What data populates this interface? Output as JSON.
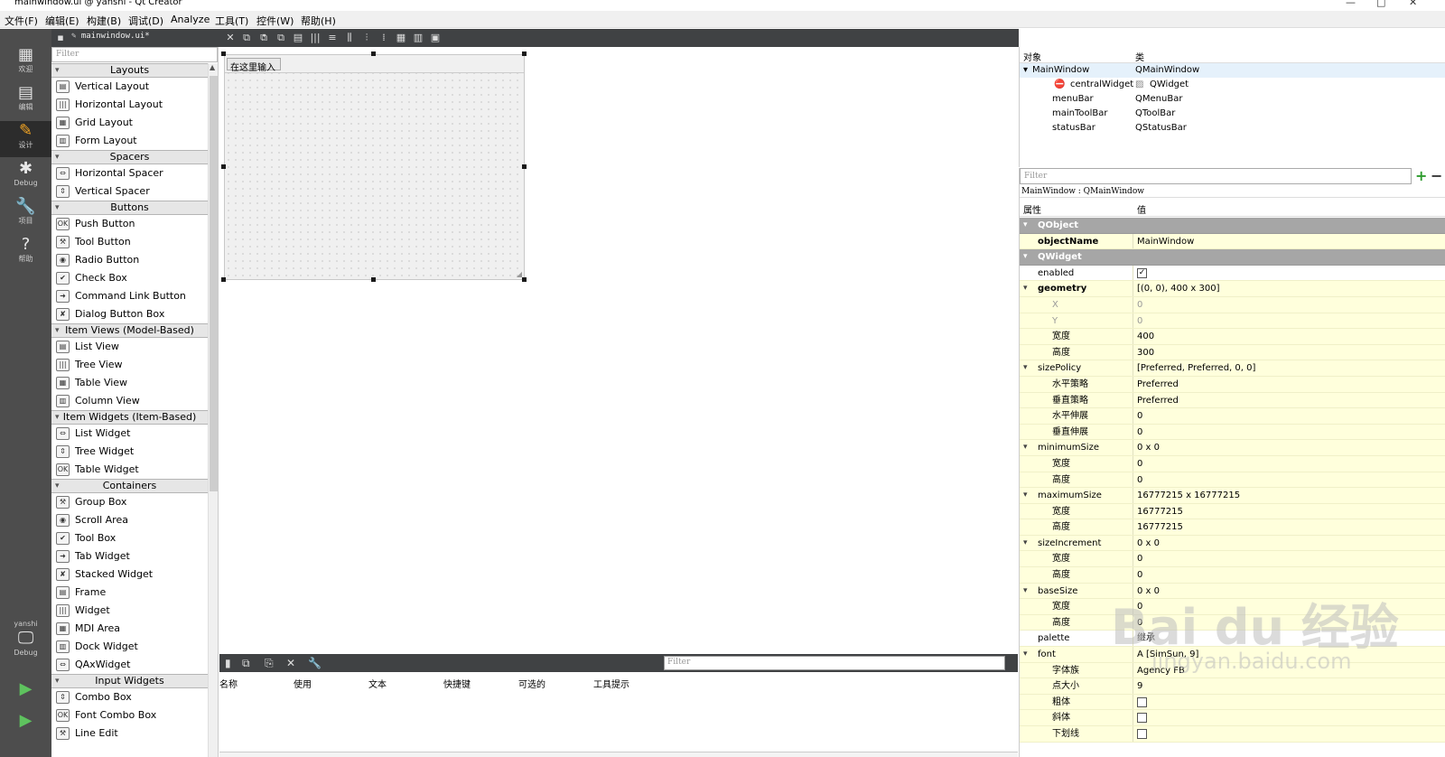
{
  "window": {
    "title": "mainwindow.ui @ yanshi - Qt Creator"
  },
  "menubar": {
    "items": [
      "文件(F)",
      "编辑(E)",
      "构建(B)",
      "调试(D)",
      "Analyze",
      "工具(T)",
      "控件(W)",
      "帮助(H)"
    ]
  },
  "modes": [
    {
      "icon": "grid-icon",
      "label": "欢迎"
    },
    {
      "icon": "edit-icon",
      "label": "编辑"
    },
    {
      "icon": "design-icon",
      "label": "设计"
    },
    {
      "icon": "debug-icon",
      "label": "Debug"
    },
    {
      "icon": "project-icon",
      "label": "项目"
    },
    {
      "icon": "help-icon",
      "label": "帮助"
    }
  ],
  "kit": {
    "project": "yanshi",
    "mode": "Debug"
  },
  "toolbar": {
    "document": "mainwindow.ui*"
  },
  "widgetbox": {
    "filter_placeholder": "Filter",
    "categories": [
      {
        "name": "Layouts",
        "items": [
          "Vertical Layout",
          "Horizontal Layout",
          "Grid Layout",
          "Form Layout"
        ]
      },
      {
        "name": "Spacers",
        "items": [
          "Horizontal Spacer",
          "Vertical Spacer"
        ]
      },
      {
        "name": "Buttons",
        "items": [
          "Push Button",
          "Tool Button",
          "Radio Button",
          "Check Box",
          "Command Link Button",
          "Dialog Button Box"
        ]
      },
      {
        "name": "Item Views (Model-Based)",
        "items": [
          "List View",
          "Tree View",
          "Table View",
          "Column View"
        ]
      },
      {
        "name": "Item Widgets (Item-Based)",
        "items": [
          "List Widget",
          "Tree Widget",
          "Table Widget"
        ]
      },
      {
        "name": "Containers",
        "items": [
          "Group Box",
          "Scroll Area",
          "Tool Box",
          "Tab Widget",
          "Stacked Widget",
          "Frame",
          "Widget",
          "MDI Area",
          "Dock Widget",
          "QAxWidget"
        ]
      },
      {
        "name": "Input Widgets",
        "items": [
          "Combo Box",
          "Font Combo Box",
          "Line Edit"
        ]
      }
    ]
  },
  "form": {
    "menu_placeholder": "在这里输入"
  },
  "action_editor": {
    "filter_placeholder": "Filter",
    "columns": [
      "名称",
      "使用",
      "文本",
      "快捷键",
      "可选的",
      "工具提示"
    ]
  },
  "object_inspector": {
    "headers": [
      "对象",
      "类"
    ],
    "rows": [
      {
        "object": "MainWindow",
        "class": "QMainWindow"
      },
      {
        "object": "centralWidget",
        "class": "QWidget"
      },
      {
        "object": "menuBar",
        "class": "QMenuBar"
      },
      {
        "object": "mainToolBar",
        "class": "QToolBar"
      },
      {
        "object": "statusBar",
        "class": "QStatusBar"
      }
    ]
  },
  "property_editor": {
    "filter_placeholder": "Filter",
    "class_line": "MainWindow : QMainWindow",
    "headers": [
      "属性",
      "值"
    ],
    "rows": [
      {
        "name": "QObject",
        "value": "",
        "kind": "group"
      },
      {
        "name": "objectName",
        "value": "MainWindow",
        "kind": "bold"
      },
      {
        "name": "QWidget",
        "value": "",
        "kind": "group"
      },
      {
        "name": "enabled",
        "value": "✓",
        "kind": "check"
      },
      {
        "name": "geometry",
        "value": "[(0, 0), 400 x 300]",
        "kind": "boldexp"
      },
      {
        "name": "X",
        "value": "0",
        "kind": "dimsub"
      },
      {
        "name": "Y",
        "value": "0",
        "kind": "dimsub"
      },
      {
        "name": "宽度",
        "value": "400",
        "kind": "sub"
      },
      {
        "name": "高度",
        "value": "300",
        "kind": "sub"
      },
      {
        "name": "sizePolicy",
        "value": "[Preferred, Preferred, 0, 0]",
        "kind": "exp"
      },
      {
        "name": "水平策略",
        "value": "Preferred",
        "kind": "sub"
      },
      {
        "name": "垂直策略",
        "value": "Preferred",
        "kind": "sub"
      },
      {
        "name": "水平伸展",
        "value": "0",
        "kind": "sub"
      },
      {
        "name": "垂直伸展",
        "value": "0",
        "kind": "sub"
      },
      {
        "name": "minimumSize",
        "value": "0 x 0",
        "kind": "exp"
      },
      {
        "name": "宽度",
        "value": "0",
        "kind": "sub"
      },
      {
        "name": "高度",
        "value": "0",
        "kind": "sub"
      },
      {
        "name": "maximumSize",
        "value": "16777215 x 16777215",
        "kind": "exp"
      },
      {
        "name": "宽度",
        "value": "16777215",
        "kind": "sub"
      },
      {
        "name": "高度",
        "value": "16777215",
        "kind": "sub"
      },
      {
        "name": "sizeIncrement",
        "value": "0 x 0",
        "kind": "exp"
      },
      {
        "name": "宽度",
        "value": "0",
        "kind": "sub"
      },
      {
        "name": "高度",
        "value": "0",
        "kind": "sub"
      },
      {
        "name": "baseSize",
        "value": "0 x 0",
        "kind": "exp"
      },
      {
        "name": "宽度",
        "value": "0",
        "kind": "sub"
      },
      {
        "name": "高度",
        "value": "0",
        "kind": "sub"
      },
      {
        "name": "palette",
        "value": "继承",
        "kind": "plain"
      },
      {
        "name": "font",
        "value": "A [SimSun, 9]",
        "kind": "exp"
      },
      {
        "name": "字体族",
        "value": "Agency FB",
        "kind": "sub"
      },
      {
        "name": "点大小",
        "value": "9",
        "kind": "sub"
      },
      {
        "name": "粗体",
        "value": "",
        "kind": "subcheck"
      },
      {
        "name": "斜体",
        "value": "",
        "kind": "subcheck"
      },
      {
        "name": "下划线",
        "value": "",
        "kind": "subcheck"
      }
    ]
  },
  "watermark": {
    "main": "Bai du 经验",
    "sub": "jingyan.baidu.com"
  }
}
